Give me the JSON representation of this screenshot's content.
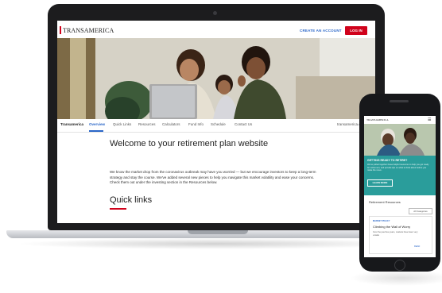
{
  "laptop": {
    "header": {
      "logo_text": "TRANSAMERICA",
      "create_account": "CREATE AN ACCOUNT",
      "log_in": "LOG IN"
    },
    "tabs": [
      {
        "label": "Transamerica"
      },
      {
        "label": "Overview"
      },
      {
        "label": "Quick Links"
      },
      {
        "label": "Resources"
      },
      {
        "label": "Calculators"
      },
      {
        "label": "Fund Info"
      },
      {
        "label": "Schedule"
      },
      {
        "label": "Contact Us"
      }
    ],
    "domain_tab": "transamerica.co",
    "main": {
      "title": "Welcome to your retirement plan website",
      "body": "We know the market drop from the coronavirus outbreak may have you worried — but we encourage investors to keep a long-term strategy and stay the course. We've added several new pieces to help you navigate this market volatility and ease your concerns. Check them out under the investing section in the Resources below.",
      "quick_links_heading": "Quick links"
    }
  },
  "phone": {
    "header": {
      "logo_text": "TRANSAMERICA"
    },
    "promo": {
      "title": "GETTING READY TO RETIRE?",
      "text": "We've pulled together these helpful resources to help you get ready for retirement, and provide tips on what to think about before you make the move.",
      "button": "LEARN MORE"
    },
    "section_title": "Retirement Resources",
    "filter": "All Categories",
    "card": {
      "tag": "MARKET POLICY",
      "title": "Climbing the Wall of Worry",
      "text": "Over the past few years, markets have been very volatile",
      "link": "READ"
    }
  },
  "colors": {
    "brand_red": "#d0021b",
    "link_blue": "#2a66c8",
    "teal": "#2a9d9b"
  }
}
